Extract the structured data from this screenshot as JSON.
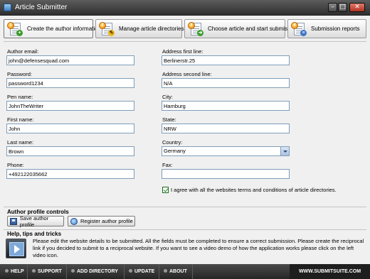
{
  "window": {
    "title": "Article Submitter",
    "minimize_glyph": "–",
    "maximize_glyph": "□",
    "close_glyph": "✕"
  },
  "steps": [
    {
      "number": "1",
      "label": "Create the author information",
      "icon": "create-profile-icon",
      "active": true
    },
    {
      "number": "2",
      "label": "Manage article directories list",
      "icon": "directories-list-icon"
    },
    {
      "number": "3",
      "label": "Choose article and start submission",
      "icon": "start-submission-icon"
    },
    {
      "number": "4",
      "label": "Submission reports",
      "icon": "reports-icon"
    }
  ],
  "form": {
    "author_email": {
      "label": "Author email:",
      "value": "john@defensesquad.com"
    },
    "password": {
      "label": "Password:",
      "value": "password1234"
    },
    "pen_name": {
      "label": "Pen name:",
      "value": "JohnTheWriter"
    },
    "first_name": {
      "label": "First name:",
      "value": "John"
    },
    "last_name": {
      "label": "Last name:",
      "value": "Brown"
    },
    "phone": {
      "label": "Phone:",
      "value": "+492122035662"
    },
    "address1": {
      "label": "Address first line:",
      "value": "Berlinerstr.25"
    },
    "address2": {
      "label": "Address second line:",
      "value": "N/A"
    },
    "city": {
      "label": "City:",
      "value": "Hamburg"
    },
    "state": {
      "label": "State:",
      "value": "NRW"
    },
    "country": {
      "label": "Country:",
      "value": "Germany"
    },
    "fax": {
      "label": "Fax:",
      "value": ""
    },
    "agree": {
      "label": "I agree with all the websites terms and conditions of article directories.",
      "checked": true
    }
  },
  "profile_controls": {
    "title": "Author profile controls",
    "save_label": "Save author profile",
    "register_label": "Register author profile"
  },
  "help": {
    "title": "Help, tips and tricks",
    "text": "Please edit the website details to be submitted. All the fields must be completed to ensure a correct submission. Please create the reciprocal link if you decided to submit to a reciprocal website. If you want to see a video demo of how the application works please click on the left video icon."
  },
  "bottom_nav": {
    "items": [
      "HELP",
      "SUPPORT",
      "ADD DIRECTORY",
      "UPDATE",
      "ABOUT"
    ],
    "site": "WWW.SUBMITSUITE.COM"
  },
  "colors": {
    "titlebar": "#3c3c3c",
    "bottombar": "#2f2f2f",
    "input_border": "#7f9db9",
    "step_number": "#f08a00"
  }
}
